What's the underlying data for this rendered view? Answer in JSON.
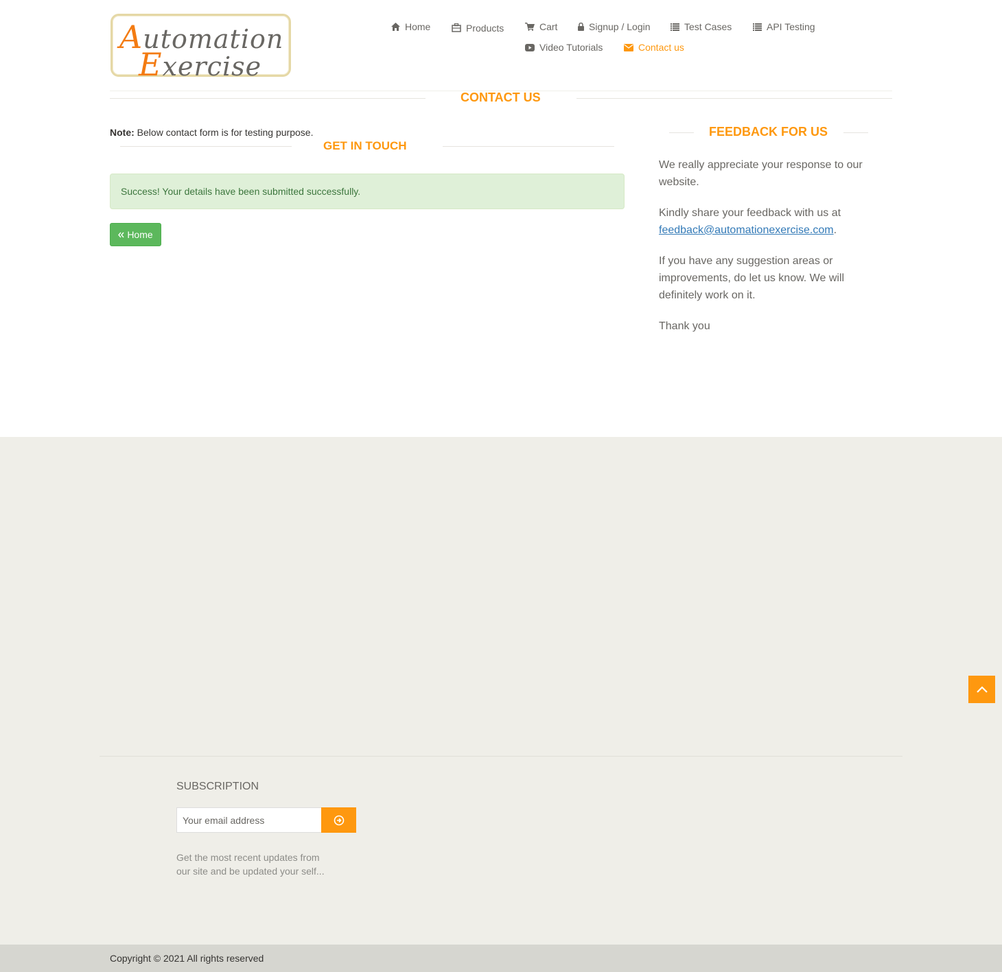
{
  "logo": {
    "line1_cap": "A",
    "line1_rest": "utomation",
    "line2_cap": "E",
    "line2_rest": "xercise"
  },
  "nav": {
    "home": "Home",
    "products": "Products",
    "cart": "Cart",
    "signup_login": "Signup / Login",
    "test_cases": "Test Cases",
    "api_testing": "API Testing",
    "video_tutorials": "Video Tutorials",
    "contact_us": "Contact us"
  },
  "page_title": "Contact Us",
  "note_label": "Note:",
  "note_text": " Below contact form is for testing purpose.",
  "get_in_touch": "Get In Touch",
  "alert_text": "Success! Your details have been submitted successfully.",
  "home_button": "Home",
  "feedback": {
    "title": "Feedback For Us",
    "p1": "We really appreciate your response to our website.",
    "p2_text": "Kindly share your feedback with us at",
    "p2_email": "feedback@automationexercise.com",
    "p2_end": ".",
    "p3": "If you have any suggestion areas or improvements, do let us know. We will definitely work on it.",
    "p4": "Thank you"
  },
  "subscription": {
    "title": "Subscription",
    "placeholder": "Your email address",
    "description": "Get the most recent updates from our site and be updated your self..."
  },
  "copyright": "Copyright © 2021 All rights reserved",
  "colors": {
    "accent": "#fe980f",
    "success_bg": "#dff0d8",
    "success_text": "#3c763d",
    "button_green": "#5cb85c",
    "footer_bg": "#efeee8"
  },
  "icons": [
    "home-icon",
    "products-icon",
    "cart-icon",
    "lock-icon",
    "list-icon",
    "youtube-icon",
    "envelope-icon",
    "double-chevron-left-icon",
    "arrow-circle-right-icon",
    "chevron-up-icon"
  ]
}
